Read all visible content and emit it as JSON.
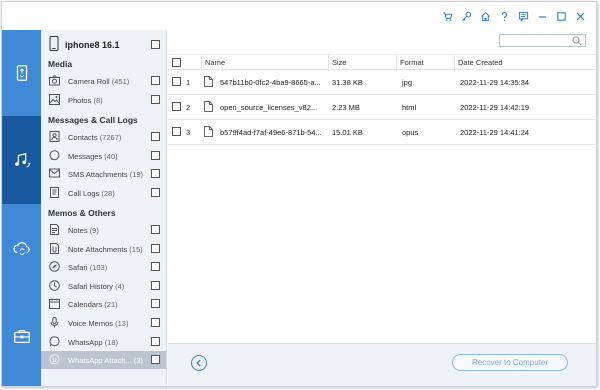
{
  "titlebar": {
    "buttons": [
      "cart-icon",
      "key-icon",
      "home-icon",
      "help-icon",
      "feedback-icon",
      "minimize-icon",
      "maximize-icon",
      "close-icon"
    ]
  },
  "rail": {
    "items": [
      {
        "icon": "phone-transfer-icon",
        "active": false
      },
      {
        "icon": "music-sync-icon",
        "active": true
      },
      {
        "icon": "cloud-sync-icon",
        "active": false
      },
      {
        "icon": "toolbox-icon",
        "active": false
      }
    ]
  },
  "device": {
    "name": "iphone8 16.1"
  },
  "categories": {
    "media_title": "Media",
    "media": [
      {
        "label": "Camera Roll",
        "count": "(451)",
        "icon": "camera-icon"
      },
      {
        "label": "Photos",
        "count": "(8)",
        "icon": "photos-icon"
      }
    ],
    "messages_title": "Messages & Call Logs",
    "messages": [
      {
        "label": "Contacts",
        "count": "(7267)",
        "icon": "contacts-icon"
      },
      {
        "label": "Messages",
        "count": "(40)",
        "icon": "messages-icon"
      },
      {
        "label": "SMS Attachments",
        "count": "(19)",
        "icon": "sms-attachment-icon"
      },
      {
        "label": "Call Logs",
        "count": "(28)",
        "icon": "call-log-icon"
      }
    ],
    "memos_title": "Memos & Others",
    "memos": [
      {
        "label": "Notes",
        "count": "(9)",
        "icon": "notes-icon"
      },
      {
        "label": "Note Attachments",
        "count": "(15)",
        "icon": "note-attachment-icon"
      },
      {
        "label": "Safari",
        "count": "(103)",
        "icon": "safari-icon"
      },
      {
        "label": "Safari History",
        "count": "(4)",
        "icon": "safari-history-icon"
      },
      {
        "label": "Calendars",
        "count": "(21)",
        "icon": "calendar-icon"
      },
      {
        "label": "Voice Memos",
        "count": "(13)",
        "icon": "voice-memo-icon"
      },
      {
        "label": "WhatsApp",
        "count": "(18)",
        "icon": "whatsapp-icon"
      },
      {
        "label": "WhatsApp Attach...",
        "count": "(3)",
        "icon": "whatsapp-attachment-icon",
        "selected": true
      }
    ]
  },
  "table": {
    "headers": {
      "name": "Name",
      "size": "Size",
      "format": "Format",
      "date": "Date Created"
    },
    "rows": [
      {
        "index": "1",
        "name": "547b11b0-0fc2-4ba9-8665-a...",
        "size": "31.38 KB",
        "format": "jpg",
        "date": "2022-11-29 14:35:34"
      },
      {
        "index": "2",
        "name": "open_source_licenses_v82...",
        "size": "2.23 MB",
        "format": "html",
        "date": "2022-11-29 14:42:19"
      },
      {
        "index": "3",
        "name": "b579f4ad-f7af-49e6-871b-54...",
        "size": "15.01 KB",
        "format": "opus",
        "date": "2022-11-29 14:41:24"
      }
    ]
  },
  "footer": {
    "recover_label": "Recover to Computer"
  },
  "colors": {
    "accent": "#3f89d6",
    "rail_active": "#17589f",
    "panel_bg": "#eef3f8"
  }
}
